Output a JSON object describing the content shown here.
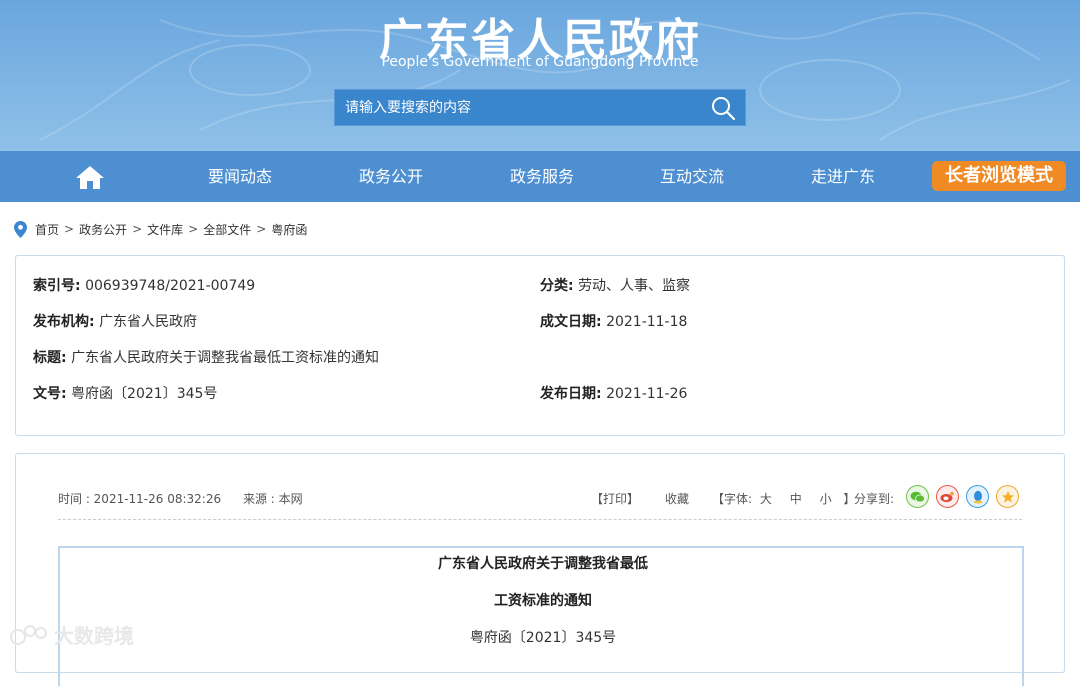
{
  "header": {
    "title": "广东省人民政府",
    "subtitle": "People's Government of Guangdong Province",
    "search_placeholder": "请输入要搜索的内容"
  },
  "nav": {
    "items": [
      "要闻动态",
      "政务公开",
      "政务服务",
      "互动交流",
      "走进广东"
    ],
    "elder_mode": "长者浏览模式"
  },
  "breadcrumb": [
    "首页",
    "政务公开",
    "文件库",
    "全部文件",
    "粤府函"
  ],
  "info": {
    "index_label": "索引号:",
    "index_value": "006939748/2021-00749",
    "category_label": "分类:",
    "category_value": "劳动、人事、监察",
    "publisher_label": "发布机构:",
    "publisher_value": "广东省人民政府",
    "written_date_label": "成文日期:",
    "written_date_value": "2021-11-18",
    "title_label": "标题:",
    "title_value": "广东省人民政府关于调整我省最低工资标准的通知",
    "doc_no_label": "文号:",
    "doc_no_value": "粤府函〔2021〕345号",
    "publish_date_label": "发布日期:",
    "publish_date_value": "2021-11-26"
  },
  "content": {
    "time": "时间 : 2021-11-26 08:32:26",
    "source": "来源 : 本网",
    "print": "【打印】",
    "favorite": "收藏",
    "font_prefix": "【字体:",
    "font_large": "大",
    "font_medium": "中",
    "font_small": "小",
    "font_suffix": "】",
    "share_label": "分享到:",
    "doc_title_line1": "广东省人民政府关于调整我省最低",
    "doc_title_line2": "工资标准的通知",
    "doc_number": "粤府函〔2021〕345号"
  },
  "watermark": "大数跨境",
  "colors": {
    "banner": "#7db3e2",
    "nav": "#4d8fd1",
    "elder_button": "#f08a24",
    "border": "#c8dcef"
  }
}
